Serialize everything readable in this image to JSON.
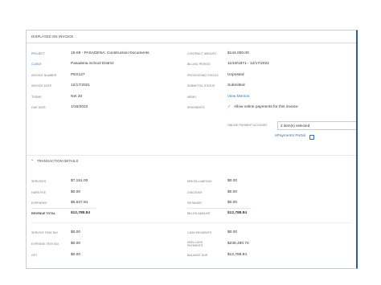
{
  "invoice": {
    "title": "DISPLAYED ON INVOICE",
    "left": [
      {
        "label": "PROJECT",
        "value": "19-08 - PASADENA: Construction Documents"
      },
      {
        "label": "CLIENT",
        "value": "Pasadena School District"
      },
      {
        "label": "INVOICE NUMBER",
        "value": "PES127"
      },
      {
        "label": "INVOICE DATE",
        "value": "12/17/2021"
      },
      {
        "label": "TERMS",
        "value": "Net 30"
      },
      {
        "label": "DUE DATE",
        "value": "1/16/2022"
      }
    ],
    "right": [
      {
        "label": "CONTRACT AMOUNT",
        "value": "$144,000.00"
      },
      {
        "label": "BILLING PERIOD",
        "value": "11/18/1971 - 12/17/2021"
      },
      {
        "label": "PROCESSING STATUS",
        "value": "Unposted"
      },
      {
        "label": "SUBMITTAL STATUS",
        "value": "Submitted"
      },
      {
        "label": "MEMO",
        "value": "View Memos"
      },
      {
        "label": "EPAYMENTS",
        "value": "Allow online payments for this invoice"
      }
    ],
    "online_payment_account_label": "ONLINE PAYMENT ACCOUNT",
    "online_payment_account_value": "2 item(s) selected",
    "epayments_portal": "ePayments Portal"
  },
  "transaction": {
    "title": "TRANSACTION DETAILS",
    "left_group1": [
      {
        "label": "SERVICES",
        "value": "$7,151.00"
      },
      {
        "label": "HARD FEE",
        "value": "$0.00"
      },
      {
        "label": "EXPENSES",
        "value": "$5,637.84"
      },
      {
        "label": "REVENUE TOTAL",
        "value": "$12,788.84"
      }
    ],
    "right_group1": [
      {
        "label": "MISCELLANEOUS",
        "value": "$0.00"
      },
      {
        "label": "DISCOUNT",
        "value": "$0.00"
      },
      {
        "label": "RETAINER",
        "value": "$0.00"
      },
      {
        "label": "BILLED AMOUNT",
        "value": "$12,788.84"
      }
    ],
    "left_group2": [
      {
        "label": "SERVICE ITEM TAX",
        "value": "$0.00"
      },
      {
        "label": "EXPENSE ITEM TAX",
        "value": "$0.00"
      },
      {
        "label": "GST",
        "value": "$0.00"
      }
    ],
    "right_group2": [
      {
        "label": "CASH PAYMENTS",
        "value": "$0.00"
      },
      {
        "label": "NON-CASH PAYMENTS",
        "value": "$238,480.74"
      },
      {
        "label": "BALANCE DUE",
        "value": "$12,788.84"
      }
    ]
  }
}
